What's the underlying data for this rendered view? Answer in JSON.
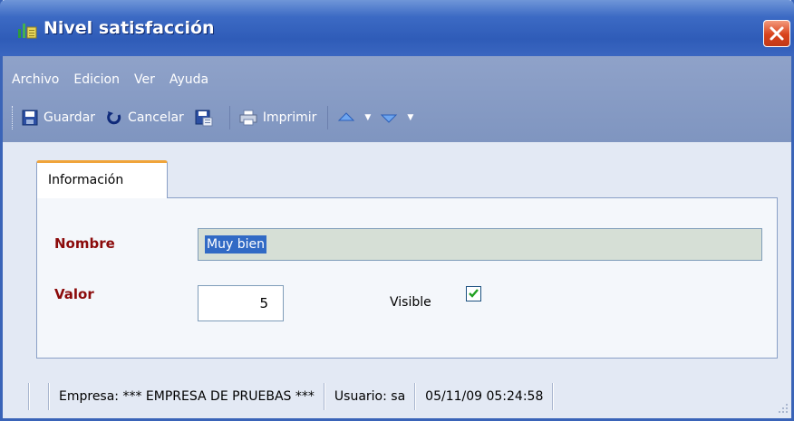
{
  "window": {
    "title": "Nivel satisfacción"
  },
  "menu": {
    "items": [
      {
        "label": "Archivo"
      },
      {
        "label": "Edicion"
      },
      {
        "label": "Ver"
      },
      {
        "label": "Ayuda"
      }
    ]
  },
  "toolbar": {
    "save_label": "Guardar",
    "cancel_label": "Cancelar",
    "print_label": "Imprimir"
  },
  "tabs": [
    {
      "label": "Información"
    }
  ],
  "form": {
    "nombre_label": "Nombre",
    "nombre_value": "Muy bien",
    "valor_label": "Valor",
    "valor_value": "5",
    "visible_label": "Visible",
    "visible_checked": true
  },
  "status": {
    "empresa": "Empresa: *** EMPRESA DE PRUEBAS ***",
    "usuario": "Usuario: sa",
    "datetime": "05/11/09 05:24:58"
  },
  "colors": {
    "title_bar": "#3c6ac4",
    "required_label": "#8b0a0a",
    "tab_accent": "#f0a43a",
    "selection": "#316ac5"
  },
  "icons": [
    "app-icon",
    "close-icon",
    "save-icon",
    "undo-icon",
    "save-as-icon",
    "print-icon",
    "arrow-up-icon",
    "arrow-down-icon"
  ]
}
